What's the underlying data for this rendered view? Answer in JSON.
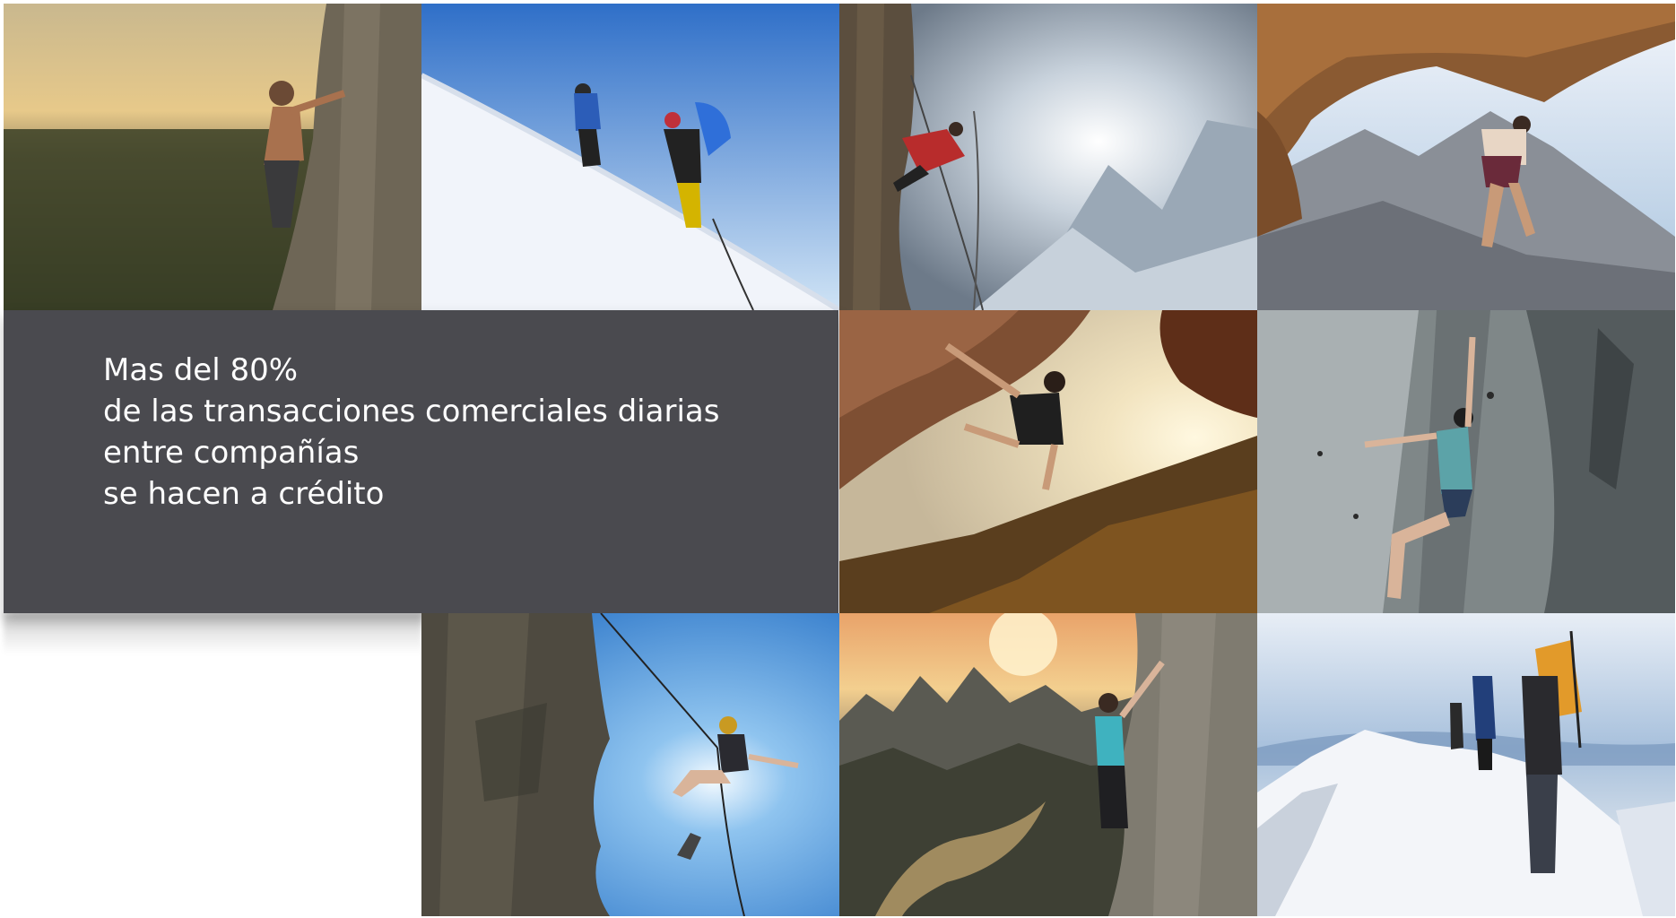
{
  "slide": {
    "text_lines": [
      "Mas del 80%",
      "de las transacciones comerciales diarias",
      "entre compañías",
      "se hacen a crédito"
    ]
  },
  "photos": [
    {
      "name": "climber-at-sunset-cliff-photo"
    },
    {
      "name": "mountaineers-on-snow-slope-photo"
    },
    {
      "name": "climber-on-rope-misty-peaks-photo"
    },
    {
      "name": "climber-under-rock-overhang-photo"
    },
    {
      "name": "climber-under-sunlit-overhang-photo"
    },
    {
      "name": "woman-climbing-grey-rock-wall-photo"
    },
    {
      "name": "climber-rappelling-blue-sky-photo"
    },
    {
      "name": "woman-climbing-karst-landscape-photo"
    },
    {
      "name": "hikers-on-snowy-ridge-photo"
    }
  ],
  "colors": {
    "panel": "#4a4a4f",
    "text": "#ffffff",
    "background": "#ffffff"
  }
}
